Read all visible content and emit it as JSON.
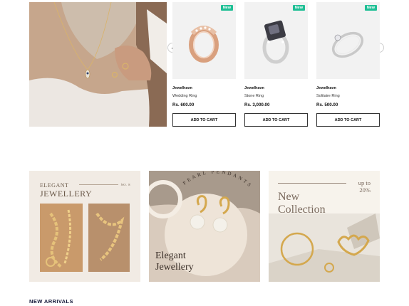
{
  "products": [
    {
      "badge": "New",
      "brand": "Jewelhavn",
      "name": "Wedding Ring",
      "price": "Rs. 600.00",
      "cta": "ADD TO CART"
    },
    {
      "badge": "New",
      "brand": "Jewelhavn",
      "name": "Stone Ring",
      "price": "Rs. 3,000.00",
      "cta": "ADD TO CART"
    },
    {
      "badge": "New",
      "brand": "Jewelhavn",
      "name": "Solitaire Ring",
      "price": "Rs. 500.00",
      "cta": "ADD TO CART"
    }
  ],
  "carousel": {
    "prev_icon": "‹",
    "next_icon": "›"
  },
  "banners": {
    "elegant": {
      "eyebrow": "ELEGANT",
      "title": "JEWELLERY",
      "number": "NO. 8"
    },
    "pendants": {
      "arc_text": "PEARL PENDANTS",
      "line1": "Elegant",
      "line2": "Jewellery"
    },
    "collection": {
      "line1": "New",
      "line2": "Collection",
      "offer1": "up to",
      "offer2": "20%"
    }
  },
  "sections": {
    "new_arrivals": "NEW ARRIVALS"
  },
  "colors": {
    "badge": "#1fbf95",
    "heading": "#151a3b"
  }
}
